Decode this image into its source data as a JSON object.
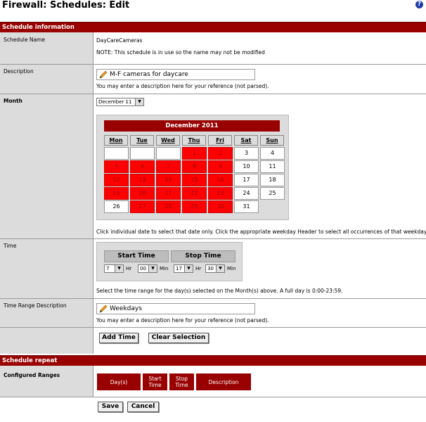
{
  "page": {
    "title": "Firewall: Schedules: Edit",
    "help_glyph": "?"
  },
  "schedule_information": {
    "header": "Schedule information",
    "name_label": "Schedule Name",
    "name_value": "DayCareCameras",
    "name_note": "NOTE: This schedule is in use so the name may not be modified",
    "description_label": "Description",
    "description_value": "M-F cameras for daycare",
    "description_help": "You may enter a description here for your reference (not parsed).",
    "month_label": "Month",
    "month_value": "December 11"
  },
  "calendar": {
    "title": "December 2011",
    "weekdays": [
      "Mon",
      "Tue",
      "Wed",
      "Thu",
      "Fri",
      "Sat",
      "Sun"
    ],
    "weeks": [
      [
        {
          "d": "",
          "s": false
        },
        {
          "d": "",
          "s": false
        },
        {
          "d": "",
          "s": false
        },
        {
          "d": "1",
          "s": true
        },
        {
          "d": "2",
          "s": true
        },
        {
          "d": "3",
          "s": false
        },
        {
          "d": "4",
          "s": false
        }
      ],
      [
        {
          "d": "5",
          "s": true
        },
        {
          "d": "6",
          "s": true
        },
        {
          "d": "7",
          "s": true
        },
        {
          "d": "8",
          "s": true
        },
        {
          "d": "9",
          "s": true
        },
        {
          "d": "10",
          "s": false
        },
        {
          "d": "11",
          "s": false
        }
      ],
      [
        {
          "d": "12",
          "s": true
        },
        {
          "d": "13",
          "s": true
        },
        {
          "d": "14",
          "s": true
        },
        {
          "d": "15",
          "s": true
        },
        {
          "d": "16",
          "s": true
        },
        {
          "d": "17",
          "s": false
        },
        {
          "d": "18",
          "s": false
        }
      ],
      [
        {
          "d": "19",
          "s": true
        },
        {
          "d": "20",
          "s": true
        },
        {
          "d": "21",
          "s": true
        },
        {
          "d": "22",
          "s": true
        },
        {
          "d": "23",
          "s": true
        },
        {
          "d": "24",
          "s": false
        },
        {
          "d": "25",
          "s": false
        }
      ],
      [
        {
          "d": "26",
          "s": false
        },
        {
          "d": "27",
          "s": true
        },
        {
          "d": "28",
          "s": true
        },
        {
          "d": "29",
          "s": true
        },
        {
          "d": "30",
          "s": true
        },
        {
          "d": "31",
          "s": false
        }
      ]
    ],
    "help": "Click individual date to select that date only. Click the appropriate weekday Header to select all occurrences of that weekday."
  },
  "time": {
    "label": "Time",
    "start_label": "Start Time",
    "stop_label": "Stop Time",
    "start_hour": "7",
    "start_min": "00",
    "stop_hour": "17",
    "stop_min": "30",
    "hr_label": "Hr",
    "min_label": "Min",
    "help": "Select the time range for the day(s) selected on the Month(s) above. A full day is 0:00-23:59."
  },
  "time_range_description": {
    "label": "Time Range Description",
    "value": "Weekdays",
    "help": "You may enter a description here for your reference (not parsed)."
  },
  "buttons": {
    "add_time": "Add Time",
    "clear_selection": "Clear Selection",
    "save": "Save",
    "cancel": "Cancel"
  },
  "schedule_repeat": {
    "header": "Schedule repeat",
    "configured_label": "Configured Ranges",
    "columns": [
      "Day(s)",
      "Start Time",
      "Stop Time",
      "Description"
    ]
  },
  "colors": {
    "section_bar": "#990000",
    "selected_day": "#ff0000",
    "label_column": "#dcdcdc"
  }
}
